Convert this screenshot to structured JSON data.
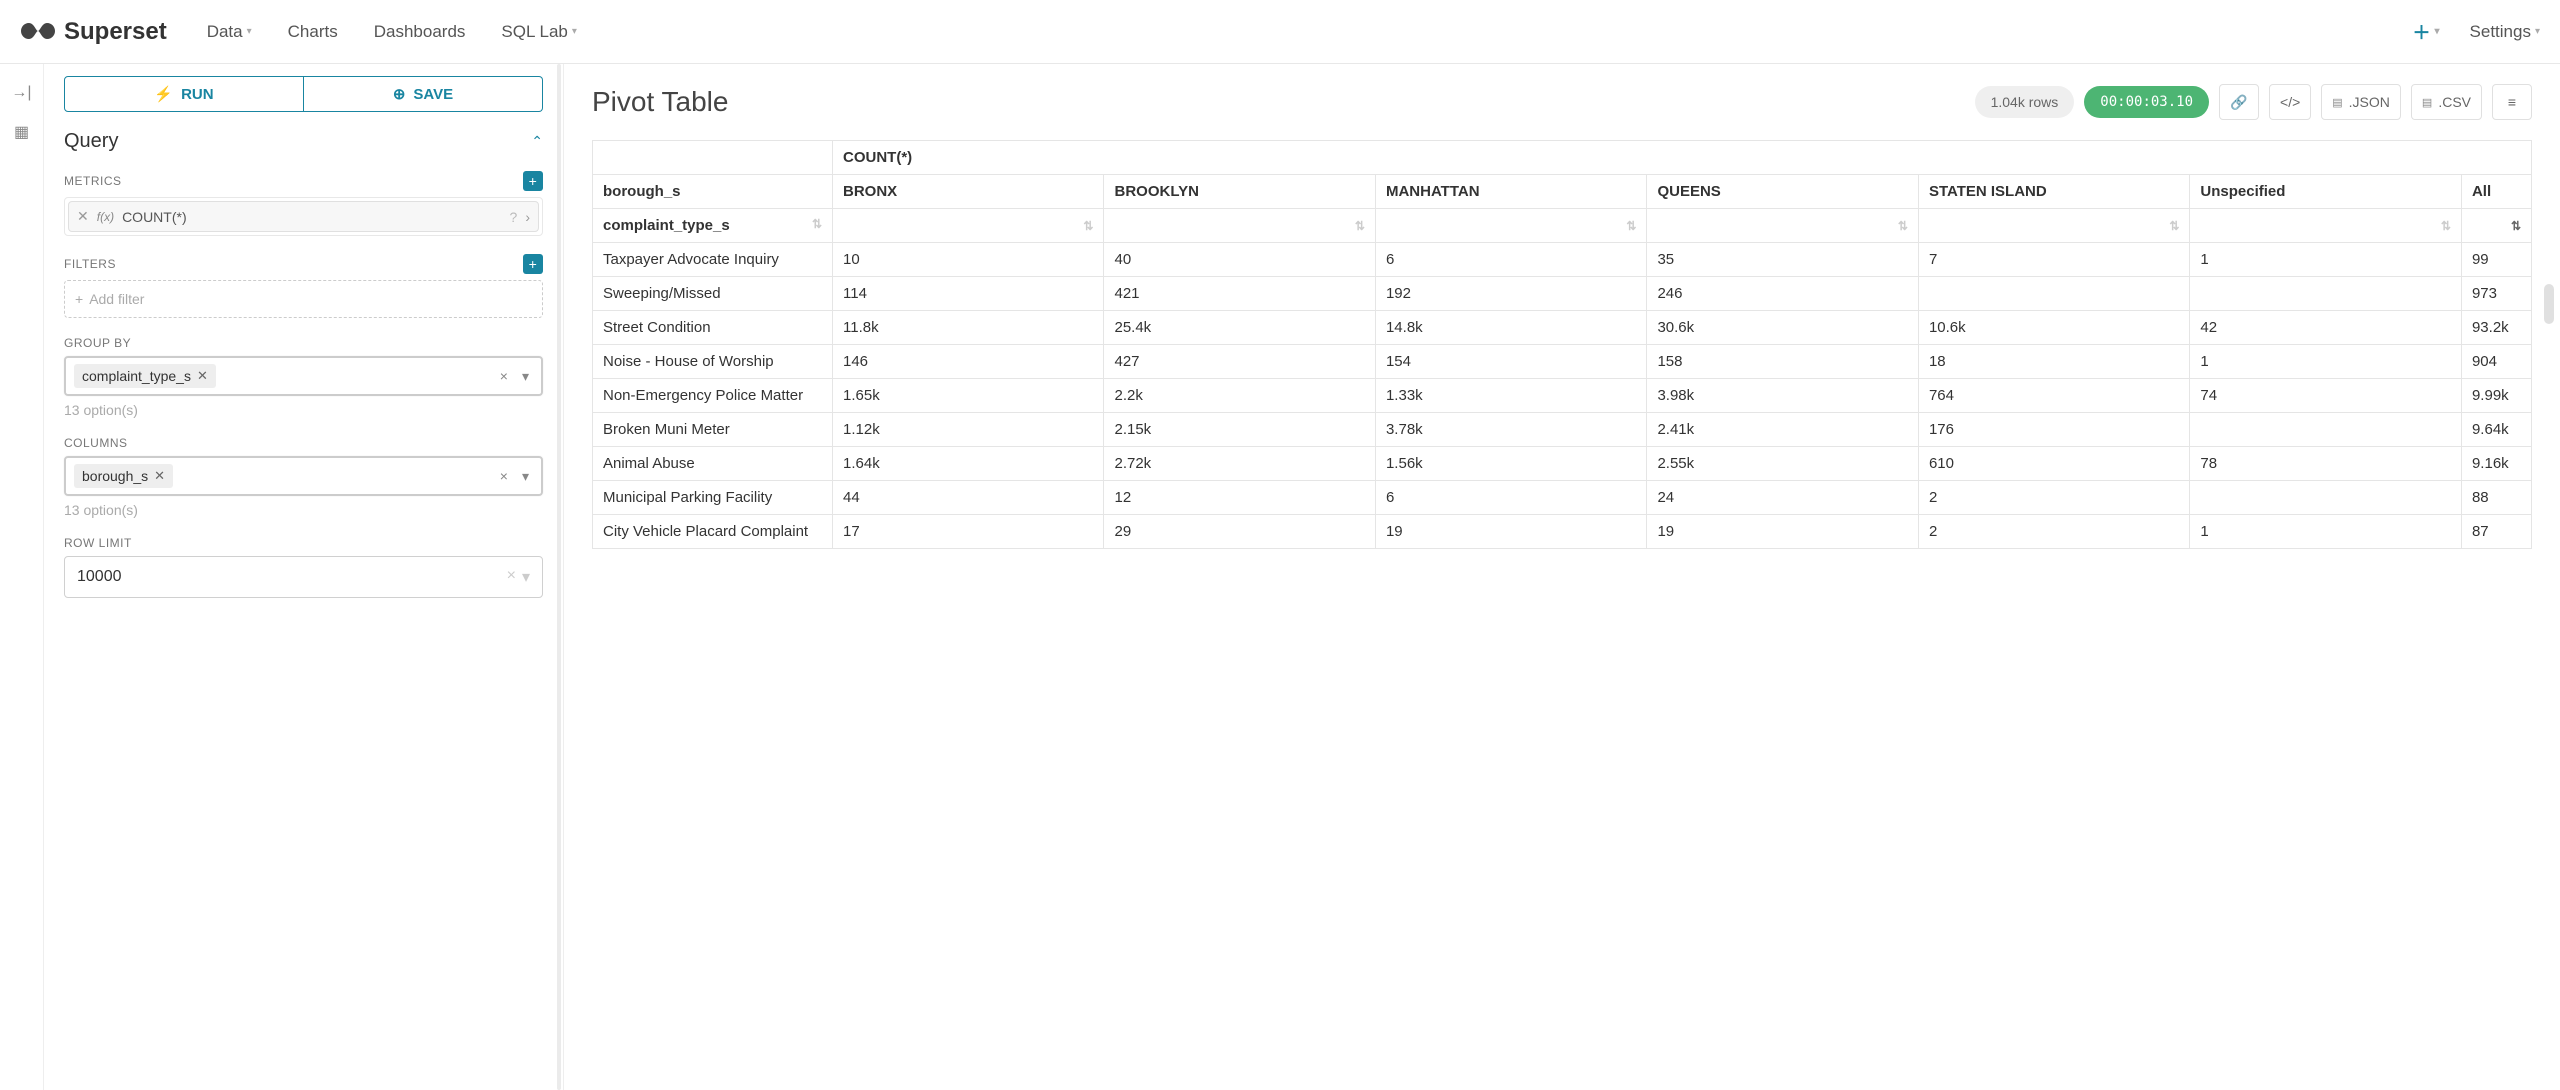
{
  "nav": {
    "brand": "Superset",
    "items": [
      "Data",
      "Charts",
      "Dashboards",
      "SQL Lab"
    ],
    "settings": "Settings"
  },
  "buttons": {
    "run": "RUN",
    "save": "SAVE"
  },
  "query": {
    "title": "Query",
    "metrics_label": "METRICS",
    "metric_value": "COUNT(*)",
    "filters_label": "FILTERS",
    "add_filter": "Add filter",
    "group_by_label": "GROUP BY",
    "group_by_value": "complaint_type_s",
    "group_by_hint": "13 option(s)",
    "columns_label": "COLUMNS",
    "columns_value": "borough_s",
    "columns_hint": "13 option(s)",
    "row_limit_label": "ROW LIMIT",
    "row_limit_value": "10000"
  },
  "header": {
    "title": "Pivot Table",
    "row_count": "1.04k rows",
    "timing": "00:00:03.10",
    "json_label": ".JSON",
    "csv_label": ".CSV"
  },
  "pivot": {
    "metric": "COUNT(*)",
    "col_dim": "borough_s",
    "row_dim": "complaint_type_s",
    "columns": [
      "BRONX",
      "BROOKLYN",
      "MANHATTAN",
      "QUEENS",
      "STATEN ISLAND",
      "Unspecified",
      "All"
    ],
    "rows": [
      {
        "label": "Taxpayer Advocate Inquiry",
        "v": [
          "10",
          "40",
          "6",
          "35",
          "7",
          "1",
          "99"
        ]
      },
      {
        "label": "Sweeping/Missed",
        "v": [
          "114",
          "421",
          "192",
          "246",
          "",
          "",
          "973"
        ]
      },
      {
        "label": "Street Condition",
        "v": [
          "11.8k",
          "25.4k",
          "14.8k",
          "30.6k",
          "10.6k",
          "42",
          "93.2k"
        ]
      },
      {
        "label": "Noise - House of Worship",
        "v": [
          "146",
          "427",
          "154",
          "158",
          "18",
          "1",
          "904"
        ]
      },
      {
        "label": "Non-Emergency Police Matter",
        "v": [
          "1.65k",
          "2.2k",
          "1.33k",
          "3.98k",
          "764",
          "74",
          "9.99k"
        ]
      },
      {
        "label": "Broken Muni Meter",
        "v": [
          "1.12k",
          "2.15k",
          "3.78k",
          "2.41k",
          "176",
          "",
          "9.64k"
        ]
      },
      {
        "label": "Animal Abuse",
        "v": [
          "1.64k",
          "2.72k",
          "1.56k",
          "2.55k",
          "610",
          "78",
          "9.16k"
        ]
      },
      {
        "label": "Municipal Parking Facility",
        "v": [
          "44",
          "12",
          "6",
          "24",
          "2",
          "",
          "88"
        ]
      },
      {
        "label": "City Vehicle Placard Complaint",
        "v": [
          "17",
          "29",
          "19",
          "19",
          "2",
          "1",
          "87"
        ]
      }
    ]
  },
  "chart_data": {
    "type": "table",
    "title": "Pivot Table",
    "metric": "COUNT(*)",
    "column_dimension": "borough_s",
    "row_dimension": "complaint_type_s",
    "columns": [
      "BRONX",
      "BROOKLYN",
      "MANHATTAN",
      "QUEENS",
      "STATEN ISLAND",
      "Unspecified",
      "All"
    ],
    "rows": [
      {
        "complaint_type_s": "Taxpayer Advocate Inquiry",
        "BRONX": 10,
        "BROOKLYN": 40,
        "MANHATTAN": 6,
        "QUEENS": 35,
        "STATEN ISLAND": 7,
        "Unspecified": 1,
        "All": 99
      },
      {
        "complaint_type_s": "Sweeping/Missed",
        "BRONX": 114,
        "BROOKLYN": 421,
        "MANHATTAN": 192,
        "QUEENS": 246,
        "STATEN ISLAND": null,
        "Unspecified": null,
        "All": 973
      },
      {
        "complaint_type_s": "Street Condition",
        "BRONX": 11800,
        "BROOKLYN": 25400,
        "MANHATTAN": 14800,
        "QUEENS": 30600,
        "STATEN ISLAND": 10600,
        "Unspecified": 42,
        "All": 93200
      },
      {
        "complaint_type_s": "Noise - House of Worship",
        "BRONX": 146,
        "BROOKLYN": 427,
        "MANHATTAN": 154,
        "QUEENS": 158,
        "STATEN ISLAND": 18,
        "Unspecified": 1,
        "All": 904
      },
      {
        "complaint_type_s": "Non-Emergency Police Matter",
        "BRONX": 1650,
        "BROOKLYN": 2200,
        "MANHATTAN": 1330,
        "QUEENS": 3980,
        "STATEN ISLAND": 764,
        "Unspecified": 74,
        "All": 9990
      },
      {
        "complaint_type_s": "Broken Muni Meter",
        "BRONX": 1120,
        "BROOKLYN": 2150,
        "MANHATTAN": 3780,
        "QUEENS": 2410,
        "STATEN ISLAND": 176,
        "Unspecified": null,
        "All": 9640
      },
      {
        "complaint_type_s": "Animal Abuse",
        "BRONX": 1640,
        "BROOKLYN": 2720,
        "MANHATTAN": 1560,
        "QUEENS": 2550,
        "STATEN ISLAND": 610,
        "Unspecified": 78,
        "All": 9160
      },
      {
        "complaint_type_s": "Municipal Parking Facility",
        "BRONX": 44,
        "BROOKLYN": 12,
        "MANHATTAN": 6,
        "QUEENS": 24,
        "STATEN ISLAND": 2,
        "Unspecified": null,
        "All": 88
      },
      {
        "complaint_type_s": "City Vehicle Placard Complaint",
        "BRONX": 17,
        "BROOKLYN": 29,
        "MANHATTAN": 19,
        "QUEENS": 19,
        "STATEN ISLAND": 2,
        "Unspecified": 1,
        "All": 87
      }
    ]
  }
}
